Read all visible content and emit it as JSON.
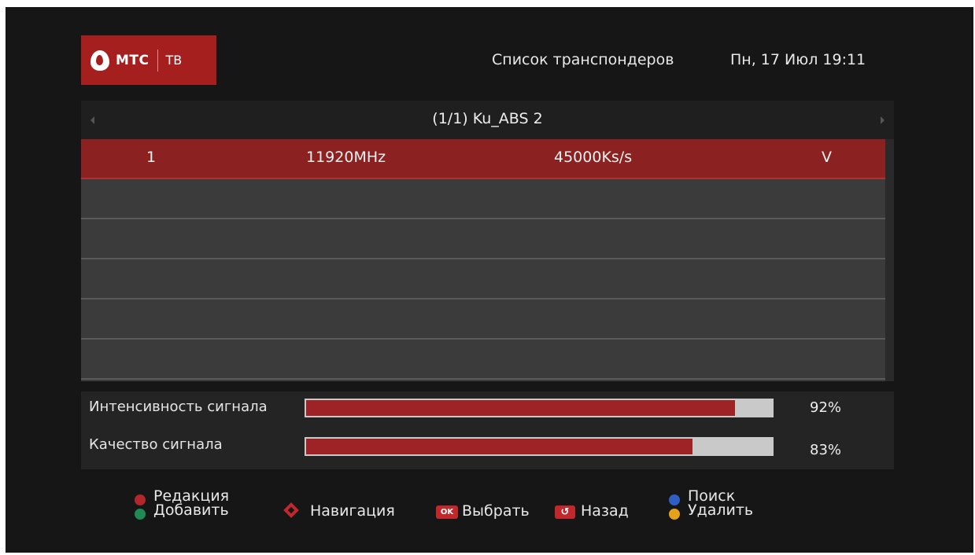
{
  "header": {
    "logo_brand": "МТС",
    "logo_service": "ТВ",
    "title": "Список транспондеров",
    "datetime": "Пн, 17 Июл 19:11"
  },
  "satellite": {
    "label": "(1/1) Ku_ABS 2"
  },
  "transponders": [
    {
      "index": "1",
      "frequency": "11920MHz",
      "symbol_rate": "45000Ks/s",
      "polarization": "V",
      "selected": true
    }
  ],
  "signal": {
    "strength_label": "Интенсивность сигнала",
    "strength_value": "92%",
    "strength_fraction": 0.92,
    "quality_label": "Качество сигнала",
    "quality_value": "83%",
    "quality_fraction": 0.83
  },
  "legend": {
    "red_label": "Редакция",
    "green_label": "Добавить",
    "nav_label": "Навигация",
    "ok_badge": "OK",
    "ok_label": "Выбрать",
    "back_label": "Назад",
    "blue_label": "Поиск",
    "yellow_label": "Удалить"
  },
  "colors": {
    "accent_red": "#a61f1f",
    "selected_row": "#8c2122",
    "red_dot": "#b3262a",
    "green_dot": "#1f8a52",
    "blue_dot": "#2f5fc4",
    "yellow_dot": "#e3a21a"
  }
}
